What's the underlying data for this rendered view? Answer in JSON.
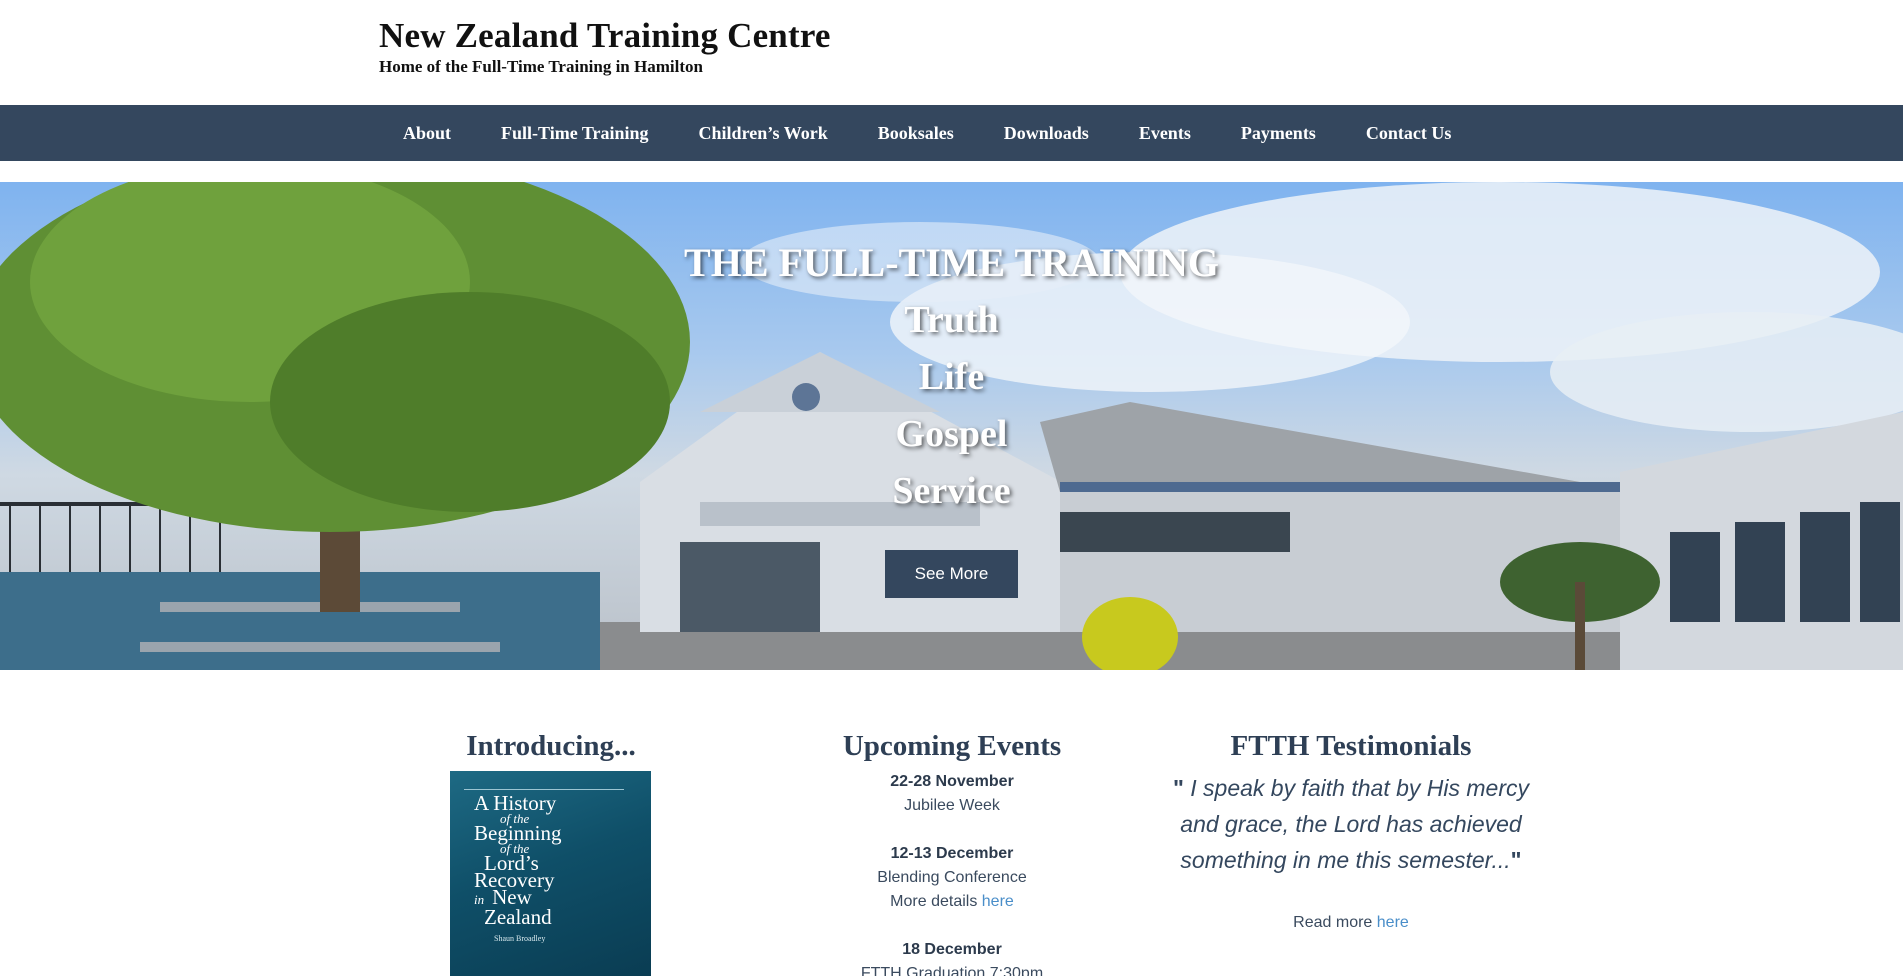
{
  "header": {
    "title": "New Zealand Training Centre",
    "tagline": "Home of the Full-Time Training in Hamilton"
  },
  "nav": {
    "items": [
      {
        "label": "About"
      },
      {
        "label": "Full-Time Training"
      },
      {
        "label": "Children’s Work"
      },
      {
        "label": "Booksales"
      },
      {
        "label": "Downloads"
      },
      {
        "label": "Events"
      },
      {
        "label": "Payments"
      },
      {
        "label": "Contact Us"
      }
    ]
  },
  "hero": {
    "heading": "THE FULL-TIME TRAINING",
    "lines": [
      "Truth",
      "Life",
      "Gospel",
      "Service"
    ],
    "button_label": "See More"
  },
  "intro": {
    "heading": "Introducing...",
    "book": {
      "title_lines": [
        "A History",
        "of the",
        "Beginning",
        "of the",
        "Lord’s",
        "Recovery",
        "in",
        "New",
        "Zealand"
      ],
      "author": "Shaun Broadley"
    }
  },
  "events": {
    "heading": "Upcoming Events",
    "items": [
      {
        "date": "22-28 November",
        "name": "Jubilee Week"
      },
      {
        "date": "12-13 December",
        "name": "Blending Conference",
        "details_prefix": "More details",
        "details_link": "here"
      },
      {
        "date": "18 December",
        "name": "FTTH Graduation 7:30pm"
      }
    ]
  },
  "testimonials": {
    "heading": "FTTH Testimonials",
    "open_quote": "\"",
    "quote": " I speak by faith that by His mercy and grace, the Lord has achieved something in me this semester...",
    "close_quote": "\"",
    "read_more_prefix": "Read more",
    "read_more_link": "here"
  },
  "colors": {
    "nav_background": "#34475e",
    "heading_text": "#2e3f55",
    "link": "#4a8ec9"
  }
}
